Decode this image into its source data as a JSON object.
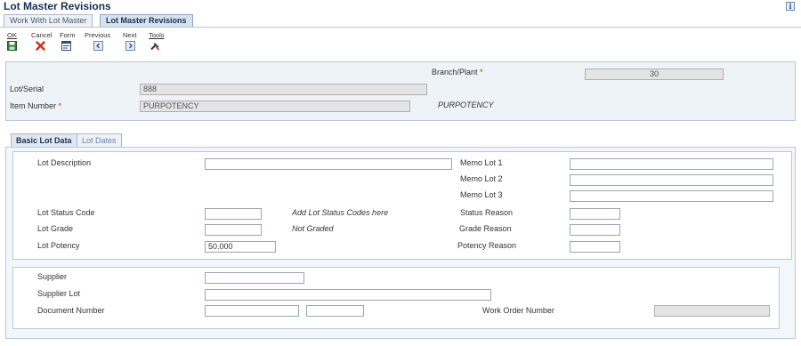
{
  "window": {
    "title": "Lot Master Revisions",
    "info_icon": "info-icon"
  },
  "top_tabs": [
    {
      "label": "Work With Lot Master",
      "active": false
    },
    {
      "label": "Lot Master Revisions",
      "active": true
    }
  ],
  "toolbar": {
    "ok": "OK",
    "cancel": "Cancel",
    "form": "Form",
    "previous": "Previous",
    "next": "Next",
    "tools": "Tools"
  },
  "header": {
    "branch_plant_label": "Branch/Plant",
    "branch_plant_value": "30",
    "lot_serial_label": "Lot/Serial",
    "lot_serial_value": "888",
    "item_number_label": "Item Number",
    "item_number_value": "PURPOTENCY",
    "item_description": "PURPOTENCY"
  },
  "inner_tabs": [
    {
      "label": "Basic Lot Data",
      "active": true
    },
    {
      "label": "Lot Dates",
      "active": false
    }
  ],
  "basic": {
    "lot_description_label": "Lot Description",
    "lot_description_value": "",
    "memo_lot_1_label": "Memo Lot 1",
    "memo_lot_2_label": "Memo Lot 2",
    "memo_lot_3_label": "Memo Lot 3",
    "lot_status_code_label": "Lot Status Code",
    "lot_status_hint": "Add Lot Status Codes here",
    "status_reason_label": "Status Reason",
    "lot_grade_label": "Lot Grade",
    "lot_grade_hint": "Not Graded",
    "grade_reason_label": "Grade Reason",
    "lot_potency_label": "Lot Potency",
    "lot_potency_value": "50.000",
    "potency_reason_label": "Potency Reason"
  },
  "supplier": {
    "supplier_label": "Supplier",
    "supplier_lot_label": "Supplier Lot",
    "document_number_label": "Document Number",
    "work_order_number_label": "Work Order Number"
  },
  "colors": {
    "accent": "#1a2f55",
    "required": "#e07a2b",
    "panel_bg": "#eef3f8"
  }
}
